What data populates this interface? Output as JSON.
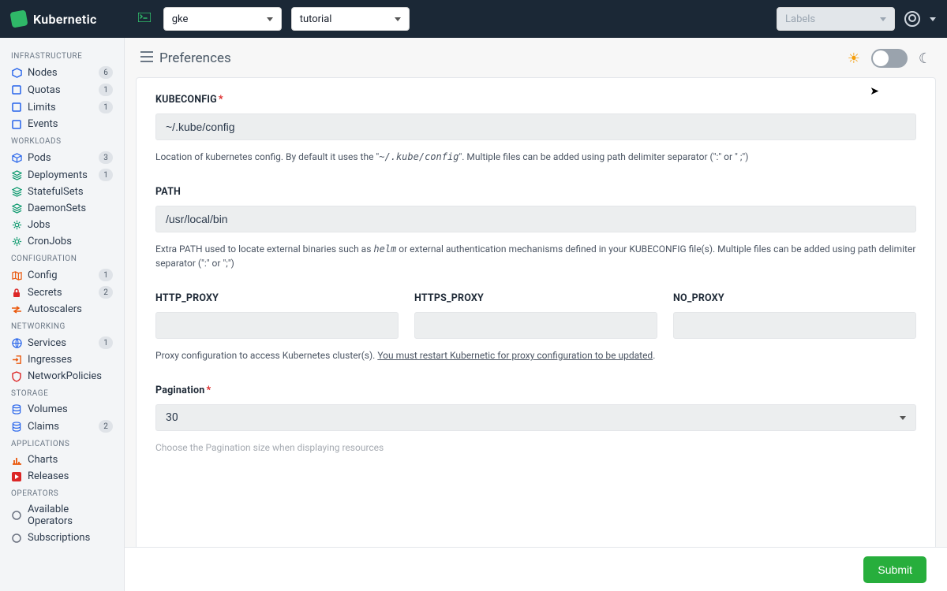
{
  "brand": "Kubernetic",
  "topbar": {
    "context_select": "gke",
    "namespace_select": "tutorial",
    "labels_select_placeholder": "Labels"
  },
  "page": {
    "title": "Preferences",
    "submit_label": "Submit"
  },
  "sidebar": {
    "sections": [
      {
        "title": "INFRASTRUCTURE",
        "items": [
          {
            "icon": "hex",
            "iconClass": "ic-blue",
            "label": "Nodes",
            "badge": "6"
          },
          {
            "icon": "sq",
            "iconClass": "ic-blue",
            "label": "Quotas",
            "badge": "1"
          },
          {
            "icon": "sq",
            "iconClass": "ic-blue",
            "label": "Limits",
            "badge": "1"
          },
          {
            "icon": "sq",
            "iconClass": "ic-blue",
            "label": "Events",
            "badge": ""
          }
        ]
      },
      {
        "title": "WORKLOADS",
        "items": [
          {
            "icon": "cube",
            "iconClass": "ic-blue",
            "label": "Pods",
            "badge": "3"
          },
          {
            "icon": "layers",
            "iconClass": "ic-green",
            "label": "Deployments",
            "badge": "1"
          },
          {
            "icon": "layers",
            "iconClass": "ic-green",
            "label": "StatefulSets",
            "badge": ""
          },
          {
            "icon": "layers",
            "iconClass": "ic-green",
            "label": "DaemonSets",
            "badge": ""
          },
          {
            "icon": "gear",
            "iconClass": "ic-green",
            "label": "Jobs",
            "badge": ""
          },
          {
            "icon": "gear",
            "iconClass": "ic-green",
            "label": "CronJobs",
            "badge": ""
          }
        ]
      },
      {
        "title": "CONFIGURATION",
        "items": [
          {
            "icon": "map",
            "iconClass": "ic-orange",
            "label": "Config",
            "badge": "1"
          },
          {
            "icon": "lock",
            "iconClass": "ic-red",
            "label": "Secrets",
            "badge": "2"
          },
          {
            "icon": "arrows",
            "iconClass": "ic-orange",
            "label": "Autoscalers",
            "badge": ""
          }
        ]
      },
      {
        "title": "NETWORKING",
        "items": [
          {
            "icon": "globe",
            "iconClass": "ic-blue",
            "label": "Services",
            "badge": "1"
          },
          {
            "icon": "login",
            "iconClass": "ic-orange",
            "label": "Ingresses",
            "badge": ""
          },
          {
            "icon": "shield",
            "iconClass": "ic-red",
            "label": "NetworkPolicies",
            "badge": ""
          }
        ]
      },
      {
        "title": "STORAGE",
        "items": [
          {
            "icon": "db",
            "iconClass": "ic-blue",
            "label": "Volumes",
            "badge": ""
          },
          {
            "icon": "db",
            "iconClass": "ic-blue",
            "label": "Claims",
            "badge": "2"
          }
        ]
      },
      {
        "title": "APPLICATIONS",
        "items": [
          {
            "icon": "chart",
            "iconClass": "ic-orange",
            "label": "Charts",
            "badge": ""
          },
          {
            "icon": "play",
            "iconClass": "ic-red",
            "label": "Releases",
            "badge": ""
          }
        ]
      },
      {
        "title": "OPERATORS",
        "items": [
          {
            "icon": "circle",
            "iconClass": "ic-gray",
            "label": "Available Operators",
            "badge": ""
          },
          {
            "icon": "circle",
            "iconClass": "ic-gray",
            "label": "Subscriptions",
            "badge": ""
          }
        ]
      }
    ]
  },
  "form": {
    "kubeconfig": {
      "label": "KUBECONFIG",
      "value": "~/.kube/config",
      "help_pre": "Location of kubernetes config. By default it uses the \"",
      "help_code": "~/.kube/config",
      "help_post": "\". Multiple files can be added using path delimiter separator (\":\" or \" ;\")"
    },
    "path": {
      "label": "PATH",
      "value": "/usr/local/bin",
      "help_pre": "Extra PATH used to locate external binaries such as ",
      "help_code": "helm",
      "help_post": " or external authentication mechanisms defined in your KUBECONFIG file(s). Multiple files can be added using path delimiter separator (\":\" or \";\")"
    },
    "proxy": {
      "http_label": "HTTP_PROXY",
      "https_label": "HTTPS_PROXY",
      "no_label": "NO_PROXY",
      "http_value": "",
      "https_value": "",
      "no_value": "",
      "help_pre": "Proxy configuration to access Kubernetes cluster(s).  ",
      "help_underline": "You must restart Kubernetic for proxy configuration to be updated",
      "help_post": "."
    },
    "pagination": {
      "label": "Pagination",
      "value": "30",
      "help": "Choose the Pagination size when displaying resources"
    }
  }
}
